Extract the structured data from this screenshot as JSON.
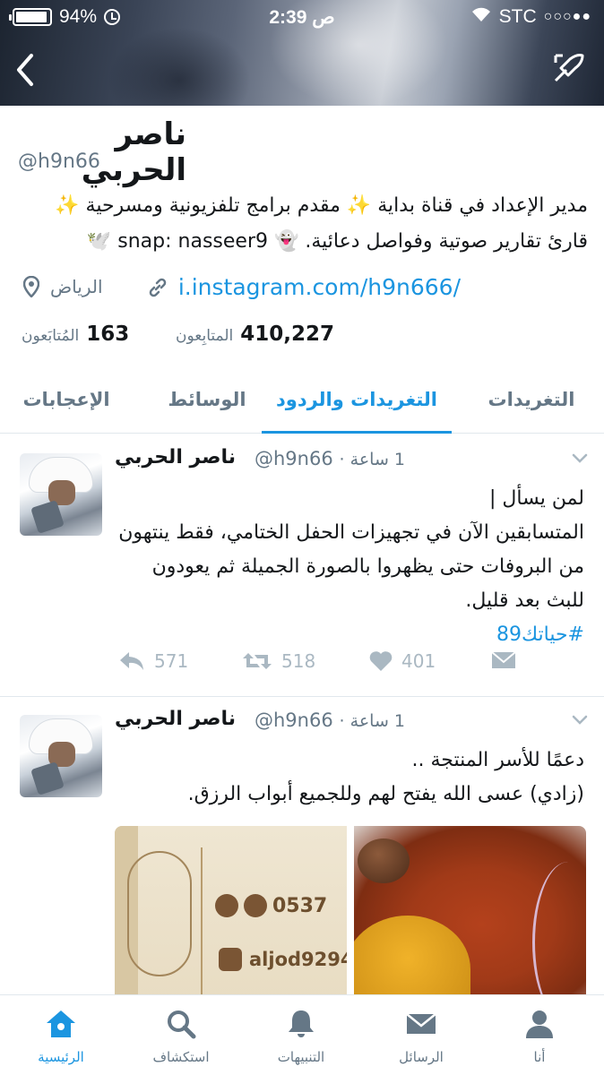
{
  "status_bar": {
    "battery": "94%",
    "time": "2:39 ص",
    "carrier": "STC",
    "signal_dots": "○○○●●"
  },
  "profile": {
    "name": "ناصر الحربي",
    "handle": "@h9n66",
    "bio_line1": "مدير الإعداد في قناة بداية ✨ مقدم برامج تلفزيونية ومسرحية ✨",
    "bio_line2": "قارئ تقارير صوتية وفواصل دعائية. 👻 snap: nasseer9 🕊️",
    "location": "الرياض",
    "link": "i.instagram.com/h9n666/",
    "followers_count": "410,227",
    "followers_label": "المتابِعون",
    "following_count": "163",
    "following_label": "المُتابَعون"
  },
  "tabs": [
    {
      "label": "التغريدات"
    },
    {
      "label": "التغريدات والردود",
      "active": true
    },
    {
      "label": "الوسائط"
    },
    {
      "label": "الإعجابات"
    }
  ],
  "tweets": [
    {
      "name": "ناصر الحربي",
      "handle": "@h9n66",
      "time": "1 ساعة ·",
      "lines": [
        "لمن يسأل |",
        "المتسابقين الآن في تجهيزات الحفل الختامي، فقط ينتهون",
        "من البروفات حتى يظهروا بالصورة الجميلة ثم يعودون",
        "للبث بعد قليل."
      ],
      "hashtag": "#حياتك89",
      "replies": "571",
      "retweets": "518",
      "likes": "401"
    },
    {
      "name": "ناصر الحربي",
      "handle": "@h9n66",
      "time": "1 ساعة ·",
      "lines": [
        "دعمًا للأسر المنتجة ..",
        "(زادي) عسى الله يفتح لهم وللجميع أبواب الرزق."
      ],
      "media_phone": "0537",
      "media_instagram": "aljod9294"
    }
  ],
  "tabbar": [
    {
      "label": "الرئيسية",
      "icon": "home-icon",
      "active": true
    },
    {
      "label": "استكشاف",
      "icon": "search-icon"
    },
    {
      "label": "التنبيهات",
      "icon": "bell-icon"
    },
    {
      "label": "الرسائل",
      "icon": "envelope-icon"
    },
    {
      "label": "أنا",
      "icon": "person-icon"
    }
  ],
  "colors": {
    "accent": "#1b95e0",
    "muted": "#657786",
    "action_gray": "#aab8c2"
  }
}
